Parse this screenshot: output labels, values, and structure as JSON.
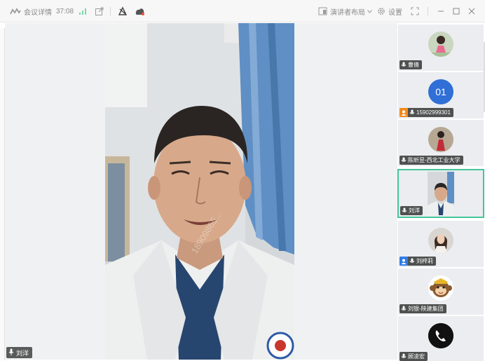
{
  "topbar": {
    "meeting_info": "会议详情",
    "timer": "37:08",
    "layout_label": "演讲者布局",
    "settings_label": "设置"
  },
  "main_video": {
    "speaker_name": "刘洋",
    "watermark": "18909865..."
  },
  "participants": [
    {
      "name": "曹倩",
      "avatar": "photo-woman-pink",
      "role": "muted"
    },
    {
      "name": "15902999301",
      "avatar": "01",
      "role": "host",
      "avatar_color": "#2f6fd6"
    },
    {
      "name": "陈昕昱-西北工业大学",
      "avatar": "photo-woman-red",
      "role": "muted"
    },
    {
      "name": "刘洋",
      "avatar": "video-thumb",
      "role": "muted",
      "active": true
    },
    {
      "name": "刘梓莉",
      "avatar": "photo-woman-white",
      "role": "cohost"
    },
    {
      "name": "刘银-陕建集团",
      "avatar": "monkey-cartoon",
      "role": "muted"
    },
    {
      "name": "顾凌宏",
      "avatar": "phone-icon",
      "role": "muted"
    }
  ],
  "colors": {
    "active_border": "#45c59b",
    "host_badge": "#f28b1e",
    "cohost_badge": "#2f7be8"
  }
}
